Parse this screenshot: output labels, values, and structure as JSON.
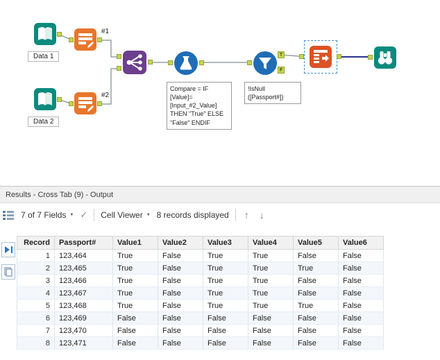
{
  "canvas": {
    "labels": {
      "data1": "Data 1",
      "data2": "Data 2",
      "conn1": "#1",
      "conn2": "#2"
    },
    "annotations": {
      "formula": "Compare = IF\n[Value]=\n[Input_#2_Value]\nTHEN \"True\" ELSE\n\"False\" ENDIF",
      "filter": "!IsNull\n([Passport#])"
    },
    "anchors": {
      "true_label": "T",
      "false_label": "F"
    },
    "tool_icon_names": [
      "input-data-icon",
      "multi-field-formula-icon",
      "union-icon",
      "formula-flask-icon",
      "filter-funnel-icon",
      "cross-tab-icon",
      "browse-binoculars-icon"
    ],
    "colors": {
      "teal": "#0b8a7d",
      "orange": "#e8762b",
      "purple": "#6d3f8f",
      "blue": "#1f6db5",
      "crosstab_orange": "#dd5226",
      "anchor_green": "#c6d64f",
      "wire_gray": "#97a0a8",
      "wire_dark": "#2e3192",
      "selection_blue": "#3f8fd2"
    }
  },
  "results": {
    "title": "Results - Cross Tab (9) - Output",
    "toolbar": {
      "fields_selector": "7 of 7 Fields",
      "cell_viewer": "Cell Viewer",
      "records_displayed": "8 records displayed"
    },
    "icons": {
      "check": "✓",
      "caret": "▼",
      "up": "↑",
      "down": "↓"
    },
    "table": {
      "columns": [
        "Record",
        "Passport#",
        "Value1",
        "Value2",
        "Value3",
        "Value4",
        "Value5",
        "Value6"
      ],
      "rows": [
        [
          "1",
          "123,464",
          "True",
          "False",
          "True",
          "True",
          "False",
          "False"
        ],
        [
          "2",
          "123,465",
          "True",
          "False",
          "True",
          "True",
          "True",
          "False"
        ],
        [
          "3",
          "123,466",
          "True",
          "False",
          "True",
          "True",
          "False",
          "False"
        ],
        [
          "4",
          "123,467",
          "True",
          "False",
          "True",
          "True",
          "False",
          "False"
        ],
        [
          "5",
          "123,468",
          "True",
          "False",
          "True",
          "True",
          "True",
          "False"
        ],
        [
          "6",
          "123,469",
          "False",
          "False",
          "False",
          "False",
          "False",
          "False"
        ],
        [
          "7",
          "123,470",
          "False",
          "False",
          "False",
          "False",
          "False",
          "False"
        ],
        [
          "8",
          "123,471",
          "False",
          "False",
          "False",
          "False",
          "False",
          "False"
        ]
      ]
    }
  }
}
